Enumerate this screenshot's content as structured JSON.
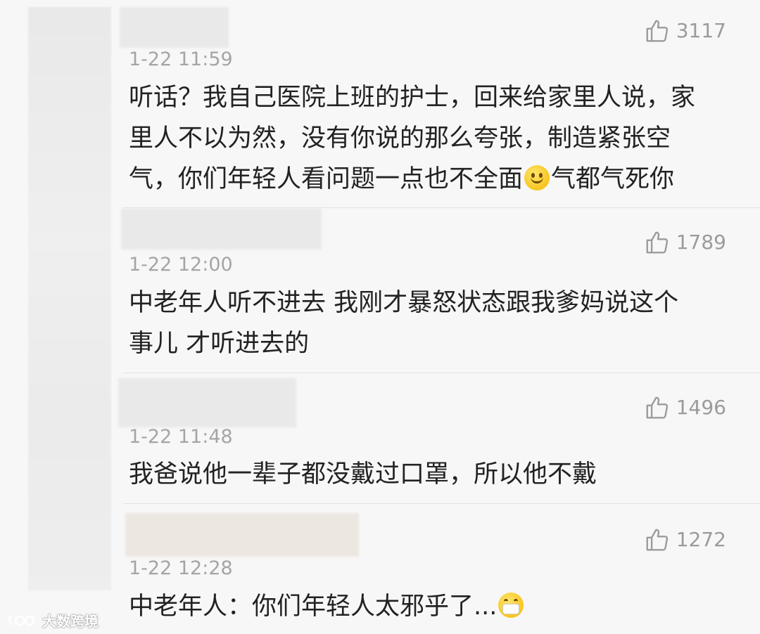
{
  "comments": [
    {
      "likes": "3117",
      "time": "1-22 11:59",
      "text_lines": [
        "听话？我自己医院上班的护士，回来给家里人说，家",
        "里人不以为然，没有你说的那么夸张，制造紧张空",
        "气，你们年轻人看问题一点也不全面"
      ],
      "text_tail": "气都气死你",
      "emoji": "smile-emoji"
    },
    {
      "likes": "1789",
      "time": "1-22 12:00",
      "text_lines": [
        "中老年人听不进去 我刚才暴怒状态跟我爹妈说这个",
        "事儿 才听进去的"
      ]
    },
    {
      "likes": "1496",
      "time": "1-22 11:48",
      "text_lines": [
        "我爸说他一辈子都没戴过口罩，所以他不戴"
      ]
    },
    {
      "likes": "1272",
      "time": "1-22 12:28",
      "text_lines": [
        "中老年人：你们年轻人太邪乎了..."
      ],
      "emoji": "mask-emoji"
    }
  ],
  "watermark": {
    "text": "大数跨境",
    "icon": "brand-logo-icon"
  },
  "colors": {
    "meta": "#9b9b9b",
    "text": "#222222",
    "background": "#f7f7f7",
    "divider": "#e2e2e2"
  }
}
